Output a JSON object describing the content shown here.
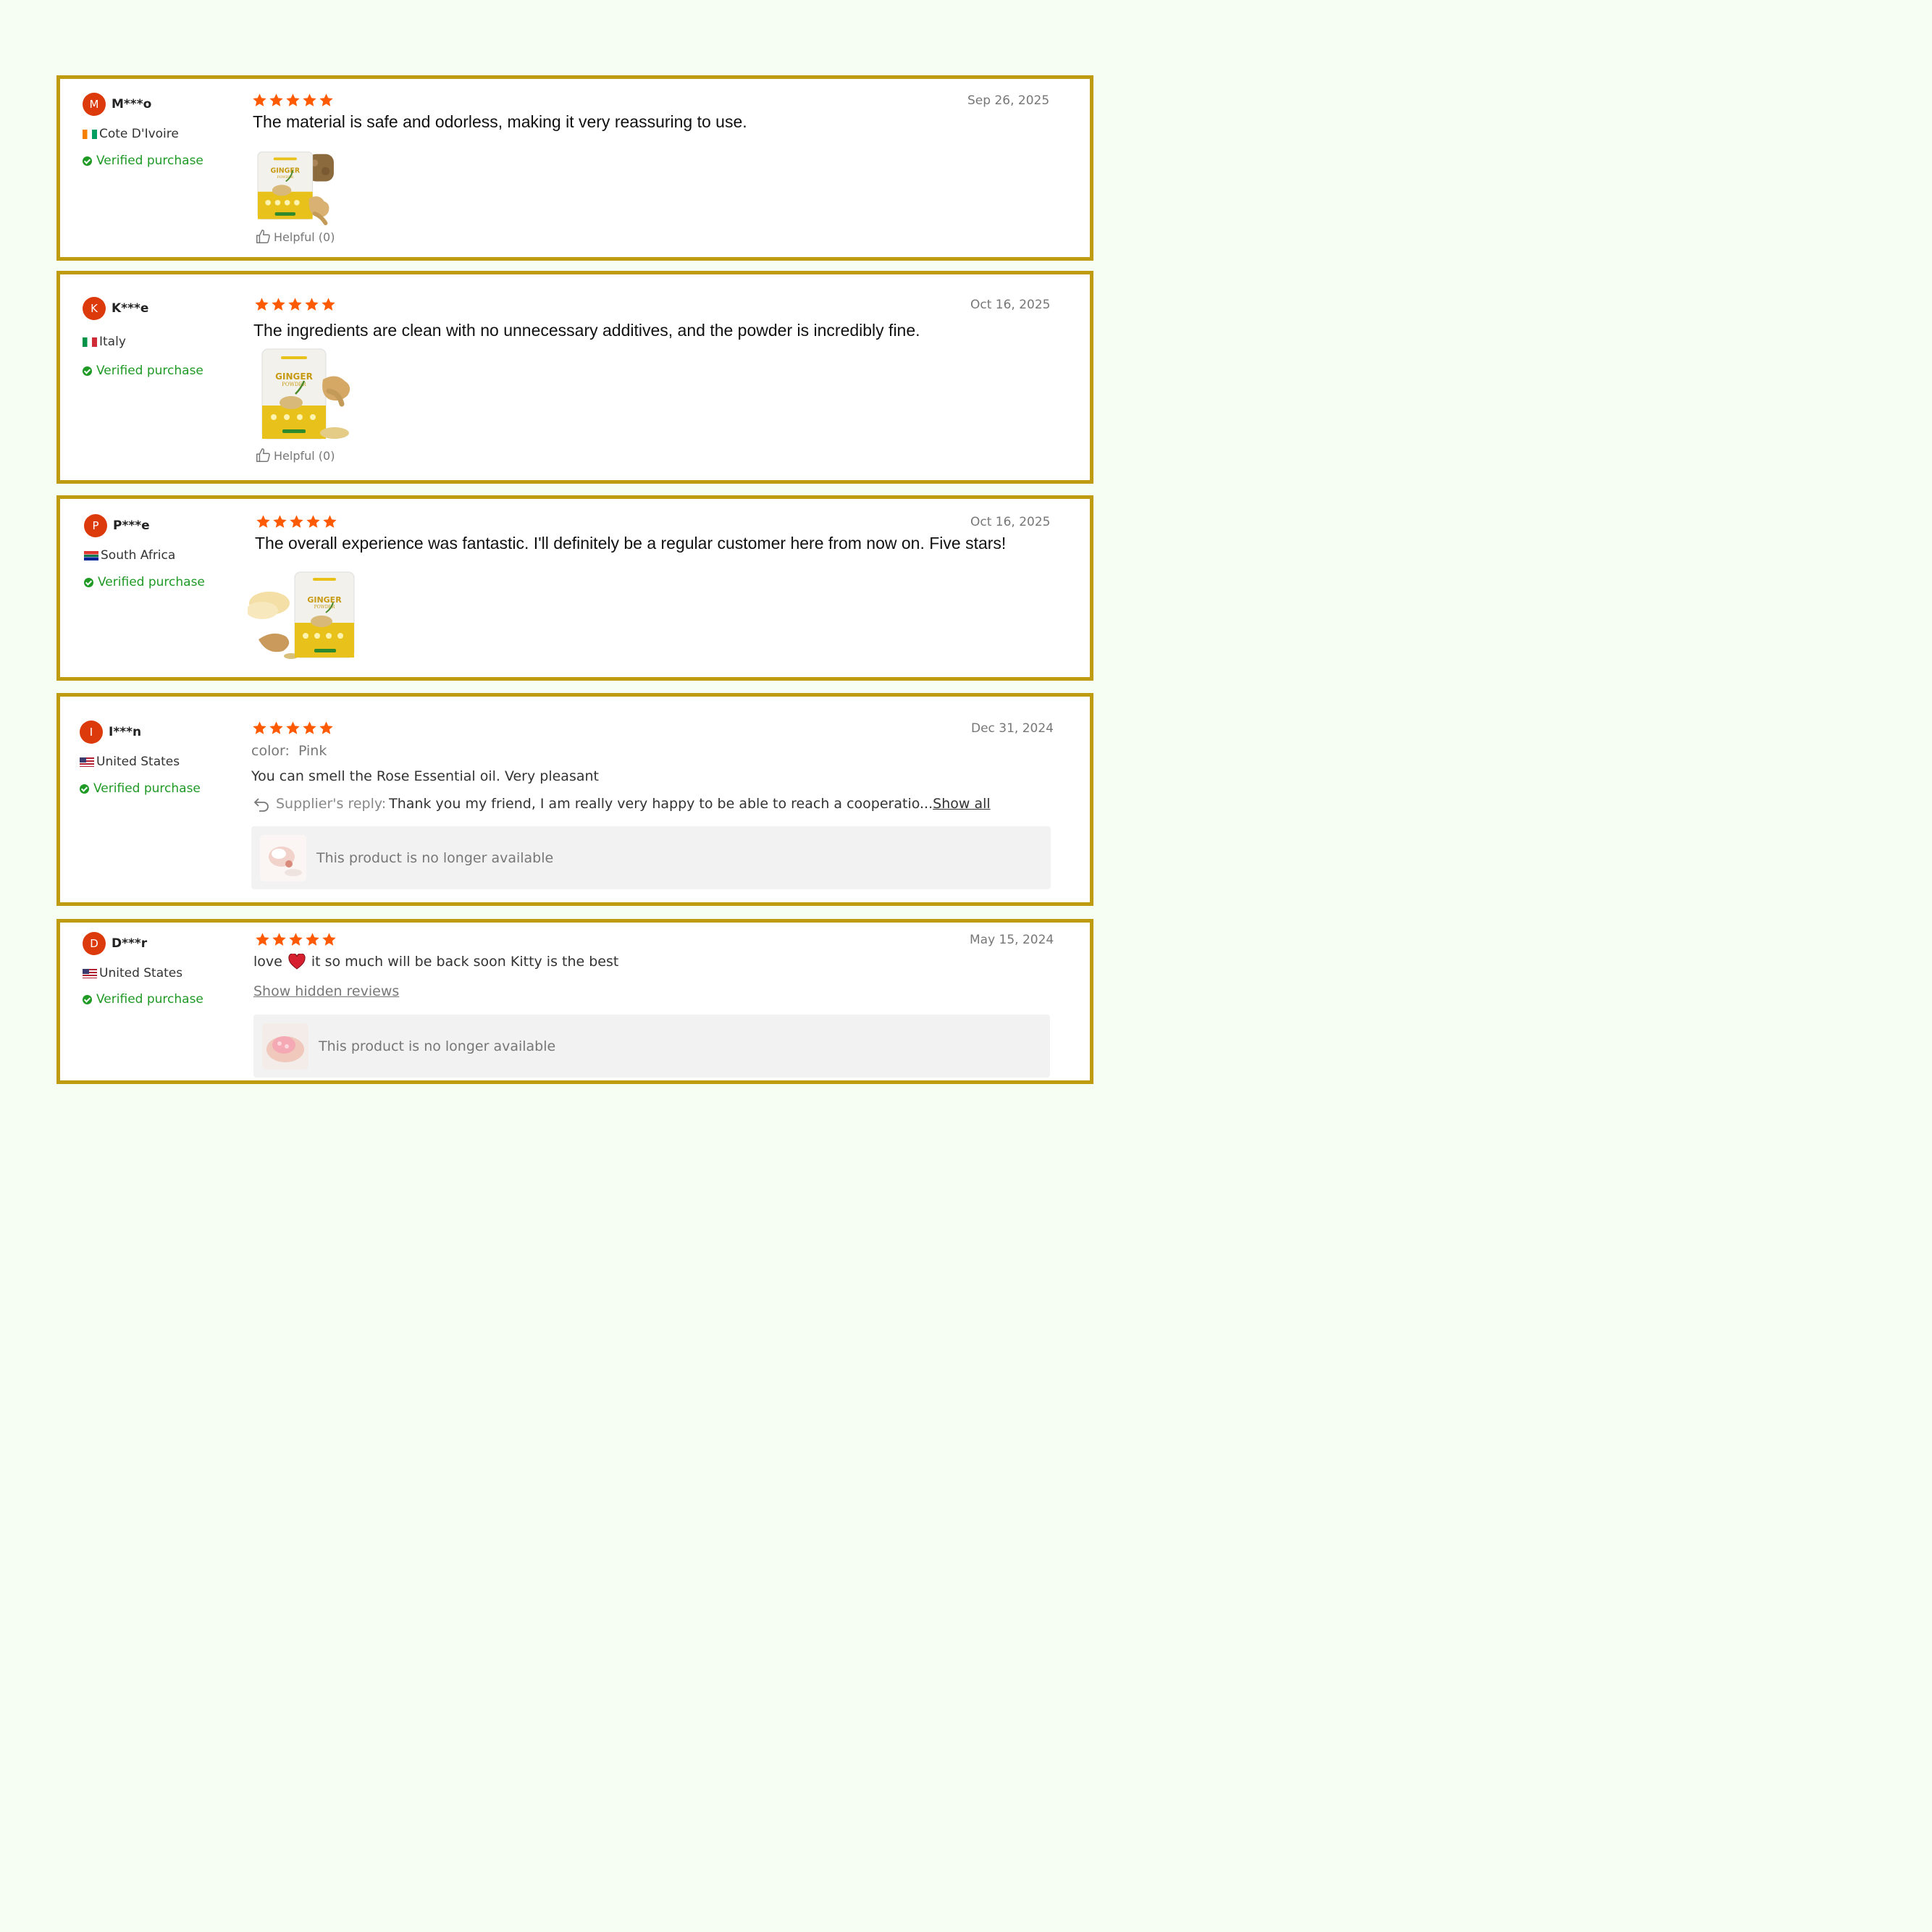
{
  "accent": {
    "frame": "#bf9b10",
    "star": "#ff5a00",
    "avatar": "#dd3a0c",
    "verified": "#1f9a25"
  },
  "reviews": [
    {
      "initial": "M",
      "user": "M***o",
      "country": "Cote D'Ivoire",
      "flag": "ivory-coast-flag",
      "verified": "Verified purchase",
      "rating": 5,
      "date": "Sep 26, 2025",
      "text": "The material is safe and odorless, making it very reassuring to use.",
      "image": "ginger-powder-pack",
      "helpful": "Helpful (0)"
    },
    {
      "initial": "K",
      "user": "K***e",
      "country": "Italy",
      "flag": "italy-flag",
      "verified": "Verified purchase",
      "rating": 5,
      "date": "Oct 16, 2025",
      "text": "The ingredients are clean with no unnecessary additives, and the powder is incredibly fine.",
      "image": "ginger-powder-pack",
      "helpful": "Helpful (0)"
    },
    {
      "initial": "P",
      "user": "P***e",
      "country": "South Africa",
      "flag": "south-africa-flag",
      "verified": "Verified purchase",
      "rating": 5,
      "date": "Oct 16, 2025",
      "text": "The overall experience was fantastic. I'll definitely be a regular customer here from now on. Five stars!",
      "image": "ginger-powder-pack"
    },
    {
      "initial": "I",
      "user": "I***n",
      "country": "United States",
      "flag": "us-flag",
      "verified": "Verified purchase",
      "rating": 5,
      "date": "Dec 31, 2024",
      "color_label": "color:",
      "color_value": "Pink",
      "text": "You can smell the Rose Essential oil. Very pleasant",
      "reply_label": "Supplier's reply:",
      "reply_text": "Thank you my friend, I am really very happy to be able to reach a cooperatio...",
      "reply_link": "Show all",
      "unavailable": "This product is no longer available"
    },
    {
      "initial": "D",
      "user": "D***r",
      "country": "United States",
      "flag": "us-flag",
      "verified": "Verified purchase",
      "rating": 5,
      "date": "May 15, 2024",
      "text_before": "love",
      "text_after": "it so much will be back soon Kitty is the best",
      "hidden_link": "Show hidden reviews",
      "unavailable": "This product is no longer available"
    }
  ]
}
